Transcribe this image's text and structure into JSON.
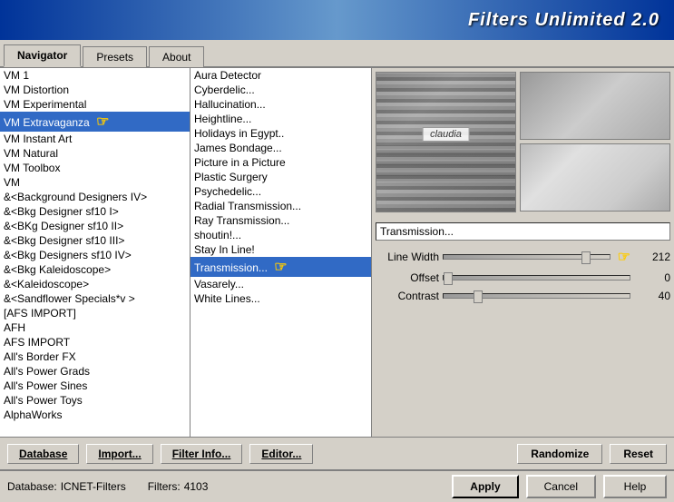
{
  "titleBar": {
    "title": "Filters Unlimited 2.0"
  },
  "tabs": [
    {
      "id": "navigator",
      "label": "Navigator",
      "active": true
    },
    {
      "id": "presets",
      "label": "Presets",
      "active": false
    },
    {
      "id": "about",
      "label": "About",
      "active": false
    }
  ],
  "leftPanel": {
    "items": [
      {
        "id": "vm1",
        "label": "VM 1",
        "selected": false
      },
      {
        "id": "vmdistortion",
        "label": "VM Distortion",
        "selected": false
      },
      {
        "id": "vmexperimental",
        "label": "VM Experimental",
        "selected": false
      },
      {
        "id": "vmextravaganza",
        "label": "VM Extravaganza",
        "selected": true
      },
      {
        "id": "vminstantart",
        "label": "VM Instant Art",
        "selected": false
      },
      {
        "id": "vmnatural",
        "label": "VM Natural",
        "selected": false
      },
      {
        "id": "vmtoolbox",
        "label": "VM Toolbox",
        "selected": false
      },
      {
        "id": "vm",
        "label": "VM",
        "selected": false
      },
      {
        "id": "bgd4",
        "label": "&<Background Designers IV>",
        "selected": false
      },
      {
        "id": "bkgsf10i",
        "label": "&<Bkg Designer sf10 I>",
        "selected": false
      },
      {
        "id": "bkgsf10ii",
        "label": "&<BKg Designer sf10 II>",
        "selected": false
      },
      {
        "id": "bkgsf10iii",
        "label": "&<Bkg Designer sf10 III>",
        "selected": false
      },
      {
        "id": "bkgsf10iv",
        "label": "&<Bkg Designers sf10 IV>",
        "selected": false
      },
      {
        "id": "bkgkaleidoscope",
        "label": "&<Bkg Kaleidoscope>",
        "selected": false
      },
      {
        "id": "kaleidoscope",
        "label": "&<Kaleidoscope>",
        "selected": false
      },
      {
        "id": "sandflower",
        "label": "&<Sandflower Specials*v >",
        "selected": false
      },
      {
        "id": "afsimport",
        "label": "[AFS IMPORT]",
        "selected": false
      },
      {
        "id": "afh",
        "label": "AFH",
        "selected": false
      },
      {
        "id": "afsimport2",
        "label": "AFS IMPORT",
        "selected": false
      },
      {
        "id": "allsborderfx",
        "label": "All's Border FX",
        "selected": false
      },
      {
        "id": "allspowergrads",
        "label": "All's Power Grads",
        "selected": false
      },
      {
        "id": "allspowersines",
        "label": "All's Power Sines",
        "selected": false
      },
      {
        "id": "allspowertoys",
        "label": "All's Power Toys",
        "selected": false
      },
      {
        "id": "alphaworks",
        "label": "AlphaWorks",
        "selected": false
      }
    ]
  },
  "filterPanel": {
    "items": [
      {
        "id": "aura",
        "label": "Aura Detector",
        "selected": false
      },
      {
        "id": "cyberdelic",
        "label": "Cyberdelic...",
        "selected": false
      },
      {
        "id": "hallucination",
        "label": "Hallucination...",
        "selected": false
      },
      {
        "id": "heightline",
        "label": "Heightline...",
        "selected": false
      },
      {
        "id": "holidays",
        "label": "Holidays in Egypt..",
        "selected": false
      },
      {
        "id": "james",
        "label": "James Bondage...",
        "selected": false
      },
      {
        "id": "picture",
        "label": "Picture in a Picture",
        "selected": false
      },
      {
        "id": "plastic",
        "label": "Plastic Surgery",
        "selected": false
      },
      {
        "id": "psychedelic",
        "label": "Psychedelic...",
        "selected": false
      },
      {
        "id": "radial",
        "label": "Radial Transmission...",
        "selected": false
      },
      {
        "id": "ray",
        "label": "Ray Transmission...",
        "selected": false
      },
      {
        "id": "shoutin",
        "label": "shoutin!...",
        "selected": false
      },
      {
        "id": "stayinline",
        "label": "Stay In Line!",
        "selected": false
      },
      {
        "id": "transmission",
        "label": "Transmission...",
        "selected": true
      },
      {
        "id": "vasarely",
        "label": "Vasarely...",
        "selected": false
      },
      {
        "id": "whitelines",
        "label": "White Lines...",
        "selected": false
      }
    ]
  },
  "previewPanel": {
    "filterName": "Transmission...",
    "sliders": [
      {
        "id": "linewidth",
        "label": "Line Width",
        "value": 212,
        "min": 0,
        "max": 255,
        "percent": 83
      },
      {
        "id": "offset",
        "label": "Offset",
        "value": 0,
        "min": 0,
        "max": 255,
        "percent": 0
      },
      {
        "id": "contrast",
        "label": "Contrast",
        "value": 40,
        "min": 0,
        "max": 255,
        "percent": 16
      }
    ],
    "previewLabel": "claudia"
  },
  "bottomToolbar": {
    "databaseLabel": "Database",
    "importLabel": "Import...",
    "filterInfoLabel": "Filter Info...",
    "editorLabel": "Editor...",
    "randomizeLabel": "Randomize",
    "resetLabel": "Reset"
  },
  "statusBar": {
    "databaseLabel": "Database:",
    "databaseValue": "ICNET-Filters",
    "filtersLabel": "Filters:",
    "filtersValue": "4103",
    "applyLabel": "Apply",
    "cancelLabel": "Cancel",
    "helpLabel": "Help"
  }
}
